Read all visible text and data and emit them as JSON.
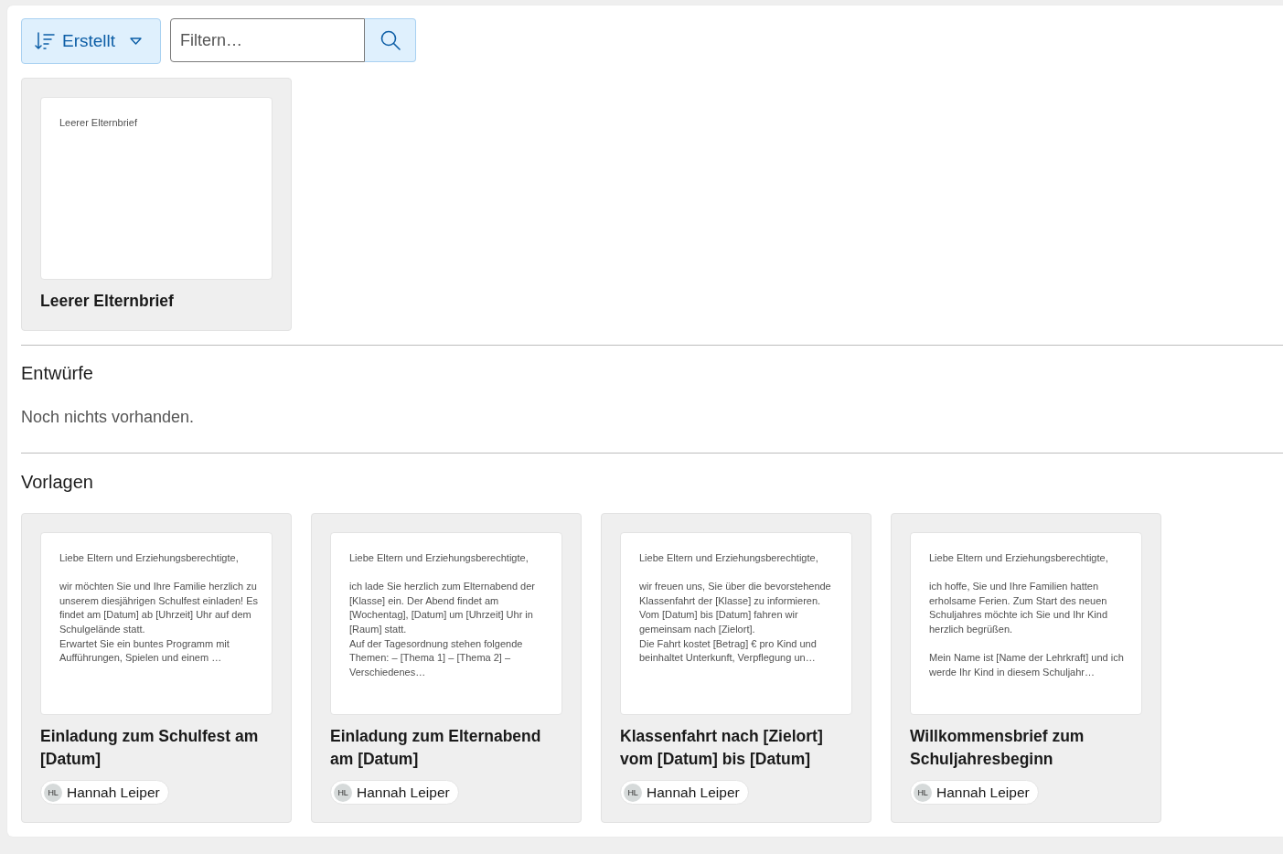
{
  "toolbar": {
    "sort": {
      "label": "Erstellt"
    },
    "filter": {
      "placeholder": "Filtern…"
    }
  },
  "blank_letters": [
    {
      "preview": "Leerer Elternbrief",
      "title": "Leerer Elternbrief"
    }
  ],
  "drafts": {
    "heading": "Entwürfe",
    "empty_message": "Noch nichts vorhanden."
  },
  "templates": {
    "heading": "Vorlagen",
    "cards": [
      {
        "preview": "Liebe Eltern und Erziehungsberechtigte,\n\nwir möchten Sie und Ihre Familie herzlich zu unserem diesjährigen Schulfest einladen! Es findet am [Datum] ab [Uhrzeit] Uhr auf dem Schulgelände statt.\nErwartet Sie ein buntes Programm mit Aufführungen, Spielen und einem …",
        "title": "Einladung zum Schulfest am [Datum]",
        "author": {
          "initials": "HL",
          "name": "Hannah Leiper"
        }
      },
      {
        "preview": "Liebe Eltern und Erziehungsberechtigte,\n\nich lade Sie herzlich zum Elternabend der [Klasse] ein. Der Abend findet am [Wochentag], [Datum] um [Uhrzeit] Uhr in [Raum] statt.\nAuf der Tagesordnung stehen folgende Themen: – [Thema 1] – [Thema 2] – Verschiedenes…",
        "title": "Einladung zum Elternabend am [Datum]",
        "author": {
          "initials": "HL",
          "name": "Hannah Leiper"
        }
      },
      {
        "preview": "Liebe Eltern und Erziehungsberechtigte,\n\nwir freuen uns, Sie über die bevorstehende Klassenfahrt der [Klasse] zu informieren. Vom [Datum] bis [Datum] fahren wir gemeinsam nach [Zielort].\nDie Fahrt kostet [Betrag] € pro Kind und beinhaltet Unterkunft, Verpflegung un…",
        "title": "Klassenfahrt nach [Zielort] vom [Datum] bis [Datum]",
        "author": {
          "initials": "HL",
          "name": "Hannah Leiper"
        }
      },
      {
        "preview": "Liebe Eltern und Erziehungsberechtigte,\n\nich hoffe, Sie und Ihre Familien hatten erholsame Ferien. Zum Start des neuen Schuljahres möchte ich Sie und Ihr Kind herzlich begrüßen.\n\nMein Name ist [Name der Lehrkraft] und ich werde Ihr Kind in diesem Schuljahr…",
        "title": "Willkommensbrief zum Schuljahresbeginn",
        "author": {
          "initials": "HL",
          "name": "Hannah Leiper"
        }
      }
    ]
  }
}
